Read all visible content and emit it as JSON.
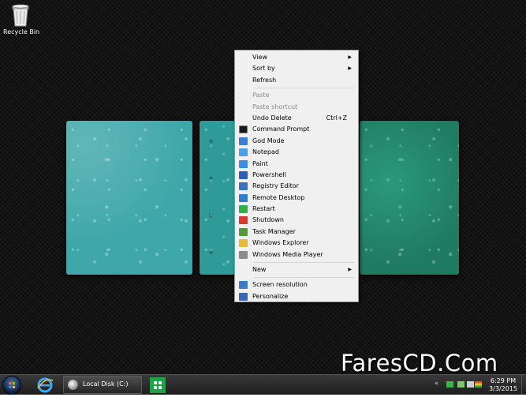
{
  "desktop": {
    "icons": [
      {
        "label": "Recycle Bin",
        "icon": "recycle-bin-icon"
      }
    ]
  },
  "context_menu": {
    "group1": [
      {
        "label": "View",
        "submenu": true
      },
      {
        "label": "Sort by",
        "submenu": true
      },
      {
        "label": "Refresh",
        "submenu": false
      }
    ],
    "group2": [
      {
        "label": "Paste",
        "disabled": true
      },
      {
        "label": "Paste shortcut",
        "disabled": true
      },
      {
        "label": "Undo Delete",
        "shortcut": "Ctrl+Z"
      }
    ],
    "group3": [
      {
        "label": "Command Prompt",
        "icon": "command-prompt-icon",
        "color": "#1a1a1a"
      },
      {
        "label": "God Mode",
        "icon": "god-mode-icon",
        "color": "#3b7fd4"
      },
      {
        "label": "Notepad",
        "icon": "notepad-icon",
        "color": "#4aa3e0"
      },
      {
        "label": "Paint",
        "icon": "paint-icon",
        "color": "#3a8ee6"
      },
      {
        "label": "Powershell",
        "icon": "powershell-icon",
        "color": "#2a5fb5"
      },
      {
        "label": "Registry Editor",
        "icon": "registry-editor-icon",
        "color": "#3c6fbf"
      },
      {
        "label": "Remote Desktop",
        "icon": "remote-desktop-icon",
        "color": "#2e7dd1"
      },
      {
        "label": "Restart",
        "icon": "restart-icon",
        "color": "#2fb14a"
      },
      {
        "label": "Shutdown",
        "icon": "shutdown-icon",
        "color": "#d83a2a"
      },
      {
        "label": "Task Manager",
        "icon": "task-manager-icon",
        "color": "#4f9b3a"
      },
      {
        "label": "Windows Explorer",
        "icon": "windows-explorer-icon",
        "color": "#e8b83a"
      },
      {
        "label": "Windows Media Player",
        "icon": "windows-media-player-icon",
        "color": "#8c8c8c"
      }
    ],
    "group4": [
      {
        "label": "New",
        "submenu": true
      }
    ],
    "group5": [
      {
        "label": "Screen resolution",
        "icon": "screen-resolution-icon",
        "color": "#3c7ac8"
      },
      {
        "label": "Personalize",
        "icon": "personalize-icon",
        "color": "#3568b8"
      }
    ]
  },
  "watermark": "FaresCD.Com",
  "taskbar": {
    "start_icon": "start-orb-icon",
    "pinned": [
      {
        "name": "internet-explorer",
        "icon": "internet-explorer-icon"
      },
      {
        "name": "local-disk",
        "label": "Local Disk (C:)",
        "icon": "drive-icon"
      },
      {
        "name": "store",
        "icon": "store-icon"
      }
    ],
    "tray": {
      "chevron": "«",
      "icons": [
        "flag-icon",
        "network-icon",
        "volume-icon",
        "battery-icon"
      ],
      "time": "6:29 PM",
      "date": "3/3/2015"
    }
  },
  "colors": {
    "menu_bg": "#f0f0f0",
    "menu_disabled_text": "#8a8a8a",
    "taskbar_bg": "#2a2a2a"
  }
}
